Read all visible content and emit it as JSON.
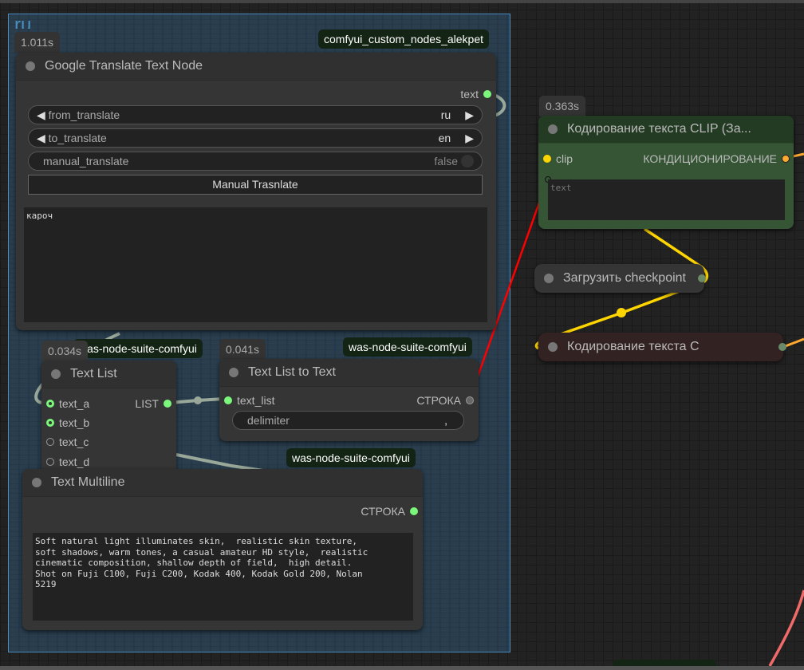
{
  "group": {
    "title": "ru"
  },
  "google_translate": {
    "time": "1.011s",
    "source": "comfyui_custom_nodes_alekpet",
    "title": "Google Translate Text Node",
    "output": "text",
    "from_label": "from_translate",
    "from_value": "ru",
    "to_label": "to_translate",
    "to_value": "en",
    "manual_label": "manual_translate",
    "manual_value": "false",
    "button": "Manual Trasnlate",
    "text": "кароч"
  },
  "clip_node": {
    "time": "0.363s",
    "title": "Кодирование текста CLIP (За...",
    "input": "clip",
    "output": "КОНДИЦИОНИРОВАНИЕ",
    "placeholder": "text"
  },
  "checkpoint": {
    "title": "Загрузить checkpoint"
  },
  "clip_node2": {
    "title": "Кодирование текста С"
  },
  "text_list": {
    "time": "0.034s",
    "source": "was-node-suite-comfyui",
    "title": "Text List",
    "inputs": [
      "text_a",
      "text_b",
      "text_c",
      "text_d"
    ],
    "output": "LIST"
  },
  "list_to_text": {
    "time": "0.041s",
    "source": "was-node-suite-comfyui",
    "title": "Text List to Text",
    "input": "text_list",
    "output": "СТРОКА",
    "delimiter_label": "delimiter",
    "delimiter_value": ","
  },
  "multiline": {
    "source": "was-node-suite-comfyui",
    "title": "Text Multiline",
    "output": "СТРОКА",
    "text": "Soft natural light illuminates skin,  realistic skin texture,\nsoft shadows, warm tones, a casual amateur HD style,  realistic\ncinematic composition, shallow depth of field,  high detail.\nShot on Fuji C100, Fuji C200, Kodak 400, Kodak Gold 200, Nolan\n5219"
  },
  "colors": {
    "string": "#7bf77b",
    "clip": "#ffd500",
    "conditioning": "#ffa931",
    "link_red": "#ff0000"
  }
}
